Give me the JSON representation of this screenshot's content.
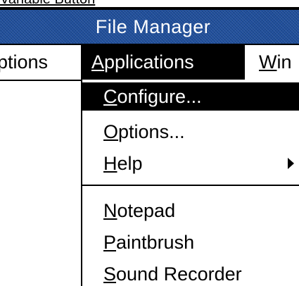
{
  "caption": {
    "text": "Variable Button"
  },
  "window": {
    "title": "File Manager"
  },
  "menubar": {
    "left_label": "ptions",
    "active": {
      "prefix": "",
      "mnemonic": "A",
      "rest": "pplications"
    },
    "right": {
      "mnemonic": "W",
      "rest": "in"
    }
  },
  "dropdown": {
    "items": [
      {
        "mnemonic": "C",
        "rest": "onfigure..."
      },
      {
        "mnemonic": "O",
        "rest": "ptions..."
      },
      {
        "mnemonic": "H",
        "rest": "elp"
      },
      {
        "mnemonic": "N",
        "rest": "otepad"
      },
      {
        "mnemonic": "P",
        "rest": "aintbrush"
      },
      {
        "mnemonic": "S",
        "rest": "ound Recorder"
      }
    ],
    "selected_index": 0,
    "submenu_arrow_item": "Help"
  },
  "colors": {
    "title_bar": "#1f4e9b",
    "highlight": "#000000",
    "highlight_text": "#ffffff"
  }
}
